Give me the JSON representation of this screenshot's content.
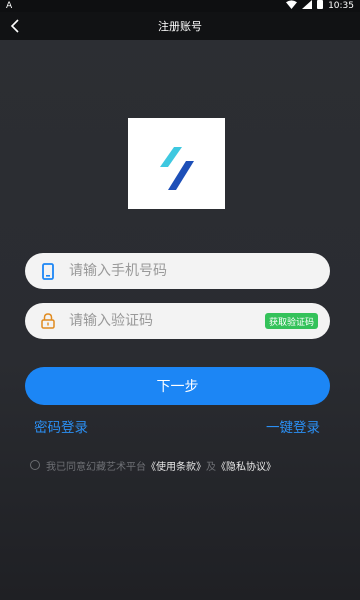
{
  "status_bar": {
    "left_indicator": "A",
    "time": "10:35"
  },
  "header": {
    "title": "注册账号"
  },
  "phone_input": {
    "placeholder": "请输入手机号码"
  },
  "code_input": {
    "placeholder": "请输入验证码",
    "get_code_label": "获取验证码"
  },
  "next_button": {
    "label": "下一步"
  },
  "links": {
    "password_login": "密码登录",
    "one_click_login": "一键登录"
  },
  "agreement": {
    "prefix": "我已同意幻藏艺术平台",
    "terms": "《使用条款》",
    "and": "及",
    "privacy": "《隐私协议》"
  },
  "colors": {
    "primary": "#1c86f5",
    "link": "#2b8ff3",
    "get_code_green": "#34c25a",
    "logo_cyan": "#3ec8e0",
    "logo_blue": "#1d4fb8"
  }
}
